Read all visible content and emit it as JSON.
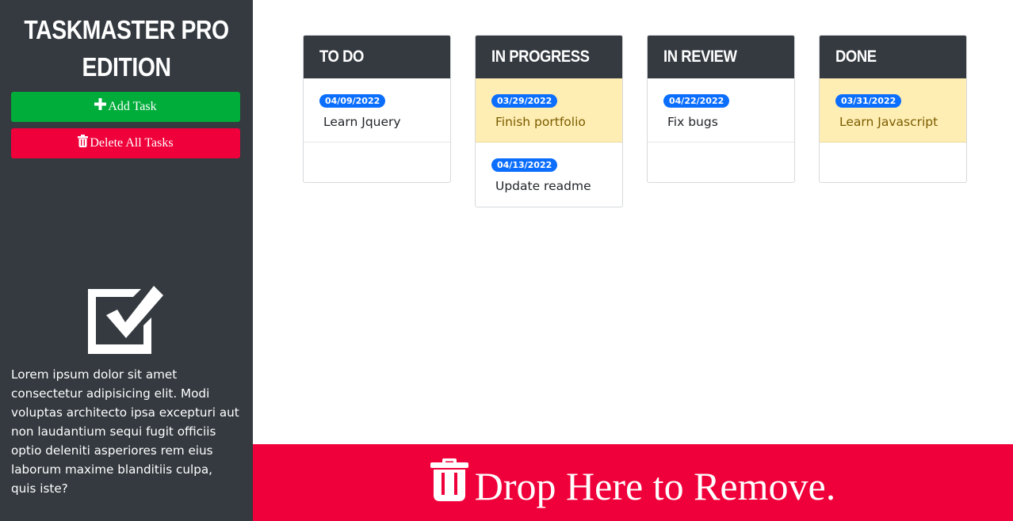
{
  "sidebar": {
    "title": "TASKMASTER PRO EDITION",
    "add_button_label": "Add Task",
    "add_button_icon": "plus-icon",
    "delete_button_label": "Delete All Tasks",
    "delete_button_icon": "trash-icon",
    "logo_icon": "checkbox-icon",
    "description": "Lorem ipsum dolor sit amet consectetur adipisicing elit. Modi voluptas architecto ipsa excepturi aut non laudantium sequi fugit officiis optio deleniti asperiores rem eius laborum maxime blanditiis culpa, quis iste?"
  },
  "columns": [
    {
      "title": "TO DO",
      "tasks": [
        {
          "date": "04/09/2022",
          "text": "Learn Jquery",
          "highlighted": false
        }
      ]
    },
    {
      "title": "IN PROGRESS",
      "tasks": [
        {
          "date": "03/29/2022",
          "text": "Finish portfolio",
          "highlighted": true
        },
        {
          "date": "04/13/2022",
          "text": "Update readme",
          "highlighted": false
        }
      ]
    },
    {
      "title": "IN REVIEW",
      "tasks": [
        {
          "date": "04/22/2022",
          "text": "Fix bugs",
          "highlighted": false
        }
      ]
    },
    {
      "title": "DONE",
      "tasks": [
        {
          "date": "03/31/2022",
          "text": "Learn Javascript",
          "highlighted": true
        }
      ]
    }
  ],
  "dropzone": {
    "label": "Drop Here to Remove.",
    "icon": "trash-icon"
  },
  "colors": {
    "sidebar_bg": "#343a40",
    "add_button": "#00ad3a",
    "delete_button": "#f0003a",
    "badge": "#0b6efd",
    "highlight": "#ffeeb3"
  }
}
